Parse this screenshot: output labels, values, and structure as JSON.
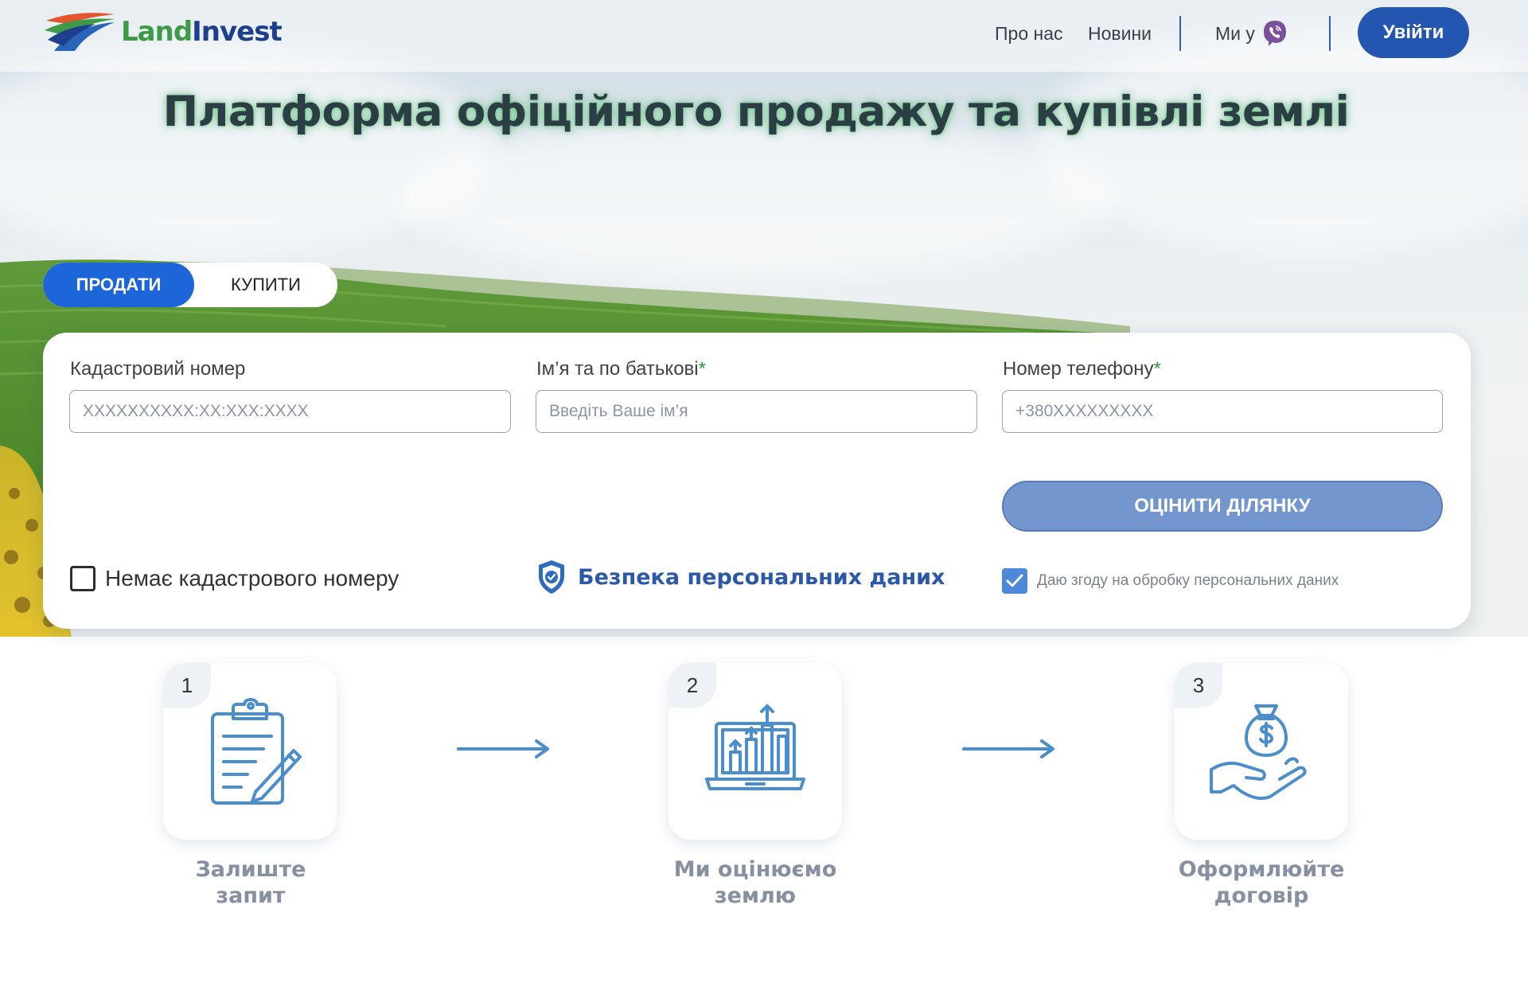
{
  "header": {
    "logo": {
      "part1": "Land",
      "part2": "Invest"
    },
    "nav": [
      {
        "label": "Про нас"
      },
      {
        "label": "Новини"
      }
    ],
    "contact_label": "Ми у",
    "login_label": "Увійти"
  },
  "hero": {
    "title": "Платформа офіційного продажу та купівлі землі"
  },
  "tabs": {
    "sell": "ПРОДАТИ",
    "buy": "КУПИТИ",
    "active": "sell"
  },
  "form": {
    "cadastral": {
      "label": "Кадастровий номер",
      "placeholder": "XXXXXXXXXX:XX:XXX:XXXX",
      "value": ""
    },
    "name": {
      "label": "Ім’я та по батькові",
      "required_mark": "*",
      "placeholder": "Введіть Ваше ім’я",
      "value": ""
    },
    "phone": {
      "label": "Номер телефону",
      "required_mark": "*",
      "placeholder": "+380XXXXXXXXX",
      "value": ""
    },
    "estimate_button": "ОЦІНИТИ ДІЛЯНКУ",
    "no_cadastral_label": "Немає кадастрового номеру",
    "no_cadastral_checked": false,
    "security_link": "Безпека персональних даних",
    "consent_label": "Даю згоду на обробку персональних даних",
    "consent_checked": true
  },
  "steps": [
    {
      "number": "1",
      "label_line1": "Залиште",
      "label_line2": "запит",
      "icon": "clipboard-icon"
    },
    {
      "number": "2",
      "label_line1": "Ми оцінюємо",
      "label_line2": "землю",
      "icon": "laptop-chart-icon"
    },
    {
      "number": "3",
      "label_line1": "Оформлюйте",
      "label_line2": "договір",
      "icon": "money-hand-icon"
    }
  ],
  "colors": {
    "primary": "#2256b0",
    "tab_active": "#1c66d9",
    "button_muted": "#7496cf",
    "icon_blue": "#4a8ecb",
    "required": "#2e9a3f"
  }
}
